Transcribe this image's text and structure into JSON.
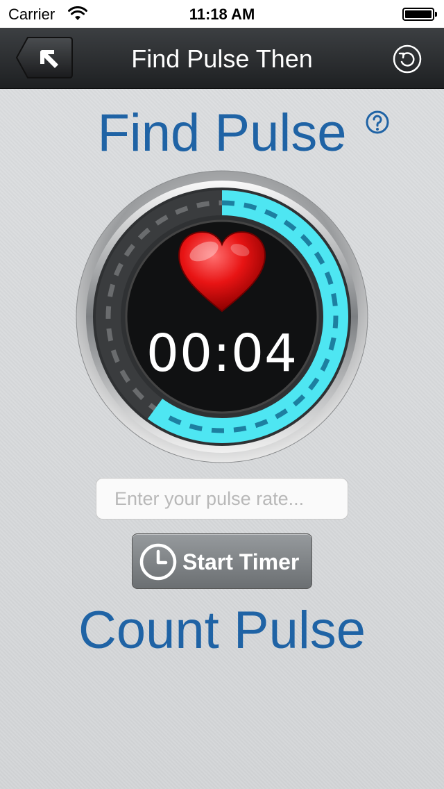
{
  "status_bar": {
    "carrier": "Carrier",
    "time": "11:18 AM"
  },
  "nav": {
    "title": "Find Pulse Then",
    "back_icon": "back-arrow-icon",
    "reset_icon": "reset-icon"
  },
  "main": {
    "find_title": "Find Pulse",
    "help_icon": "question-mark-icon",
    "timer": "00:04",
    "timer_progress": 0.6,
    "input_placeholder": "Enter your pulse rate...",
    "start_label": "Start Timer",
    "count_title": "Count Pulse"
  },
  "colors": {
    "accent": "#1f63a5",
    "ring": "#4ee6f2",
    "dash": "#1d7fa0"
  }
}
